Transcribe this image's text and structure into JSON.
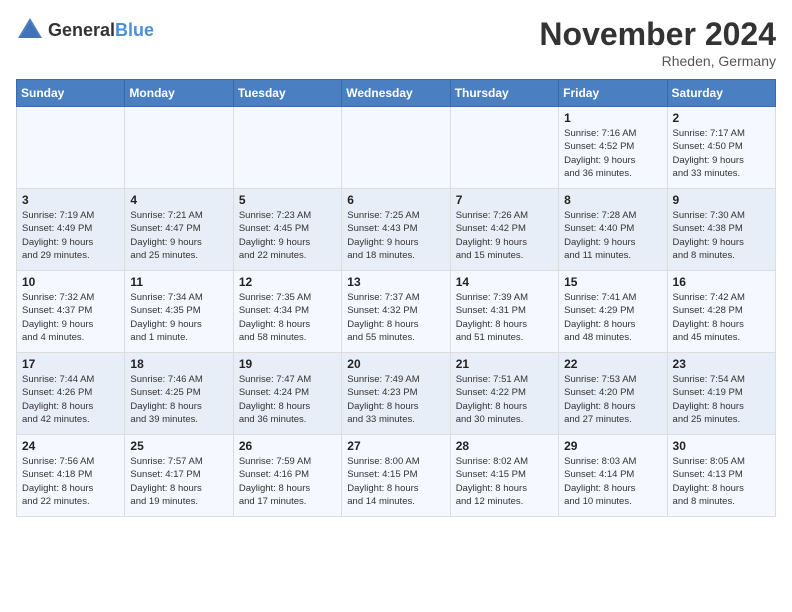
{
  "header": {
    "logo_general": "General",
    "logo_blue": "Blue",
    "month_year": "November 2024",
    "location": "Rheden, Germany"
  },
  "weekdays": [
    "Sunday",
    "Monday",
    "Tuesday",
    "Wednesday",
    "Thursday",
    "Friday",
    "Saturday"
  ],
  "weeks": [
    [
      {
        "day": "",
        "info": ""
      },
      {
        "day": "",
        "info": ""
      },
      {
        "day": "",
        "info": ""
      },
      {
        "day": "",
        "info": ""
      },
      {
        "day": "",
        "info": ""
      },
      {
        "day": "1",
        "info": "Sunrise: 7:16 AM\nSunset: 4:52 PM\nDaylight: 9 hours\nand 36 minutes."
      },
      {
        "day": "2",
        "info": "Sunrise: 7:17 AM\nSunset: 4:50 PM\nDaylight: 9 hours\nand 33 minutes."
      }
    ],
    [
      {
        "day": "3",
        "info": "Sunrise: 7:19 AM\nSunset: 4:49 PM\nDaylight: 9 hours\nand 29 minutes."
      },
      {
        "day": "4",
        "info": "Sunrise: 7:21 AM\nSunset: 4:47 PM\nDaylight: 9 hours\nand 25 minutes."
      },
      {
        "day": "5",
        "info": "Sunrise: 7:23 AM\nSunset: 4:45 PM\nDaylight: 9 hours\nand 22 minutes."
      },
      {
        "day": "6",
        "info": "Sunrise: 7:25 AM\nSunset: 4:43 PM\nDaylight: 9 hours\nand 18 minutes."
      },
      {
        "day": "7",
        "info": "Sunrise: 7:26 AM\nSunset: 4:42 PM\nDaylight: 9 hours\nand 15 minutes."
      },
      {
        "day": "8",
        "info": "Sunrise: 7:28 AM\nSunset: 4:40 PM\nDaylight: 9 hours\nand 11 minutes."
      },
      {
        "day": "9",
        "info": "Sunrise: 7:30 AM\nSunset: 4:38 PM\nDaylight: 9 hours\nand 8 minutes."
      }
    ],
    [
      {
        "day": "10",
        "info": "Sunrise: 7:32 AM\nSunset: 4:37 PM\nDaylight: 9 hours\nand 4 minutes."
      },
      {
        "day": "11",
        "info": "Sunrise: 7:34 AM\nSunset: 4:35 PM\nDaylight: 9 hours\nand 1 minute."
      },
      {
        "day": "12",
        "info": "Sunrise: 7:35 AM\nSunset: 4:34 PM\nDaylight: 8 hours\nand 58 minutes."
      },
      {
        "day": "13",
        "info": "Sunrise: 7:37 AM\nSunset: 4:32 PM\nDaylight: 8 hours\nand 55 minutes."
      },
      {
        "day": "14",
        "info": "Sunrise: 7:39 AM\nSunset: 4:31 PM\nDaylight: 8 hours\nand 51 minutes."
      },
      {
        "day": "15",
        "info": "Sunrise: 7:41 AM\nSunset: 4:29 PM\nDaylight: 8 hours\nand 48 minutes."
      },
      {
        "day": "16",
        "info": "Sunrise: 7:42 AM\nSunset: 4:28 PM\nDaylight: 8 hours\nand 45 minutes."
      }
    ],
    [
      {
        "day": "17",
        "info": "Sunrise: 7:44 AM\nSunset: 4:26 PM\nDaylight: 8 hours\nand 42 minutes."
      },
      {
        "day": "18",
        "info": "Sunrise: 7:46 AM\nSunset: 4:25 PM\nDaylight: 8 hours\nand 39 minutes."
      },
      {
        "day": "19",
        "info": "Sunrise: 7:47 AM\nSunset: 4:24 PM\nDaylight: 8 hours\nand 36 minutes."
      },
      {
        "day": "20",
        "info": "Sunrise: 7:49 AM\nSunset: 4:23 PM\nDaylight: 8 hours\nand 33 minutes."
      },
      {
        "day": "21",
        "info": "Sunrise: 7:51 AM\nSunset: 4:22 PM\nDaylight: 8 hours\nand 30 minutes."
      },
      {
        "day": "22",
        "info": "Sunrise: 7:53 AM\nSunset: 4:20 PM\nDaylight: 8 hours\nand 27 minutes."
      },
      {
        "day": "23",
        "info": "Sunrise: 7:54 AM\nSunset: 4:19 PM\nDaylight: 8 hours\nand 25 minutes."
      }
    ],
    [
      {
        "day": "24",
        "info": "Sunrise: 7:56 AM\nSunset: 4:18 PM\nDaylight: 8 hours\nand 22 minutes."
      },
      {
        "day": "25",
        "info": "Sunrise: 7:57 AM\nSunset: 4:17 PM\nDaylight: 8 hours\nand 19 minutes."
      },
      {
        "day": "26",
        "info": "Sunrise: 7:59 AM\nSunset: 4:16 PM\nDaylight: 8 hours\nand 17 minutes."
      },
      {
        "day": "27",
        "info": "Sunrise: 8:00 AM\nSunset: 4:15 PM\nDaylight: 8 hours\nand 14 minutes."
      },
      {
        "day": "28",
        "info": "Sunrise: 8:02 AM\nSunset: 4:15 PM\nDaylight: 8 hours\nand 12 minutes."
      },
      {
        "day": "29",
        "info": "Sunrise: 8:03 AM\nSunset: 4:14 PM\nDaylight: 8 hours\nand 10 minutes."
      },
      {
        "day": "30",
        "info": "Sunrise: 8:05 AM\nSunset: 4:13 PM\nDaylight: 8 hours\nand 8 minutes."
      }
    ]
  ]
}
